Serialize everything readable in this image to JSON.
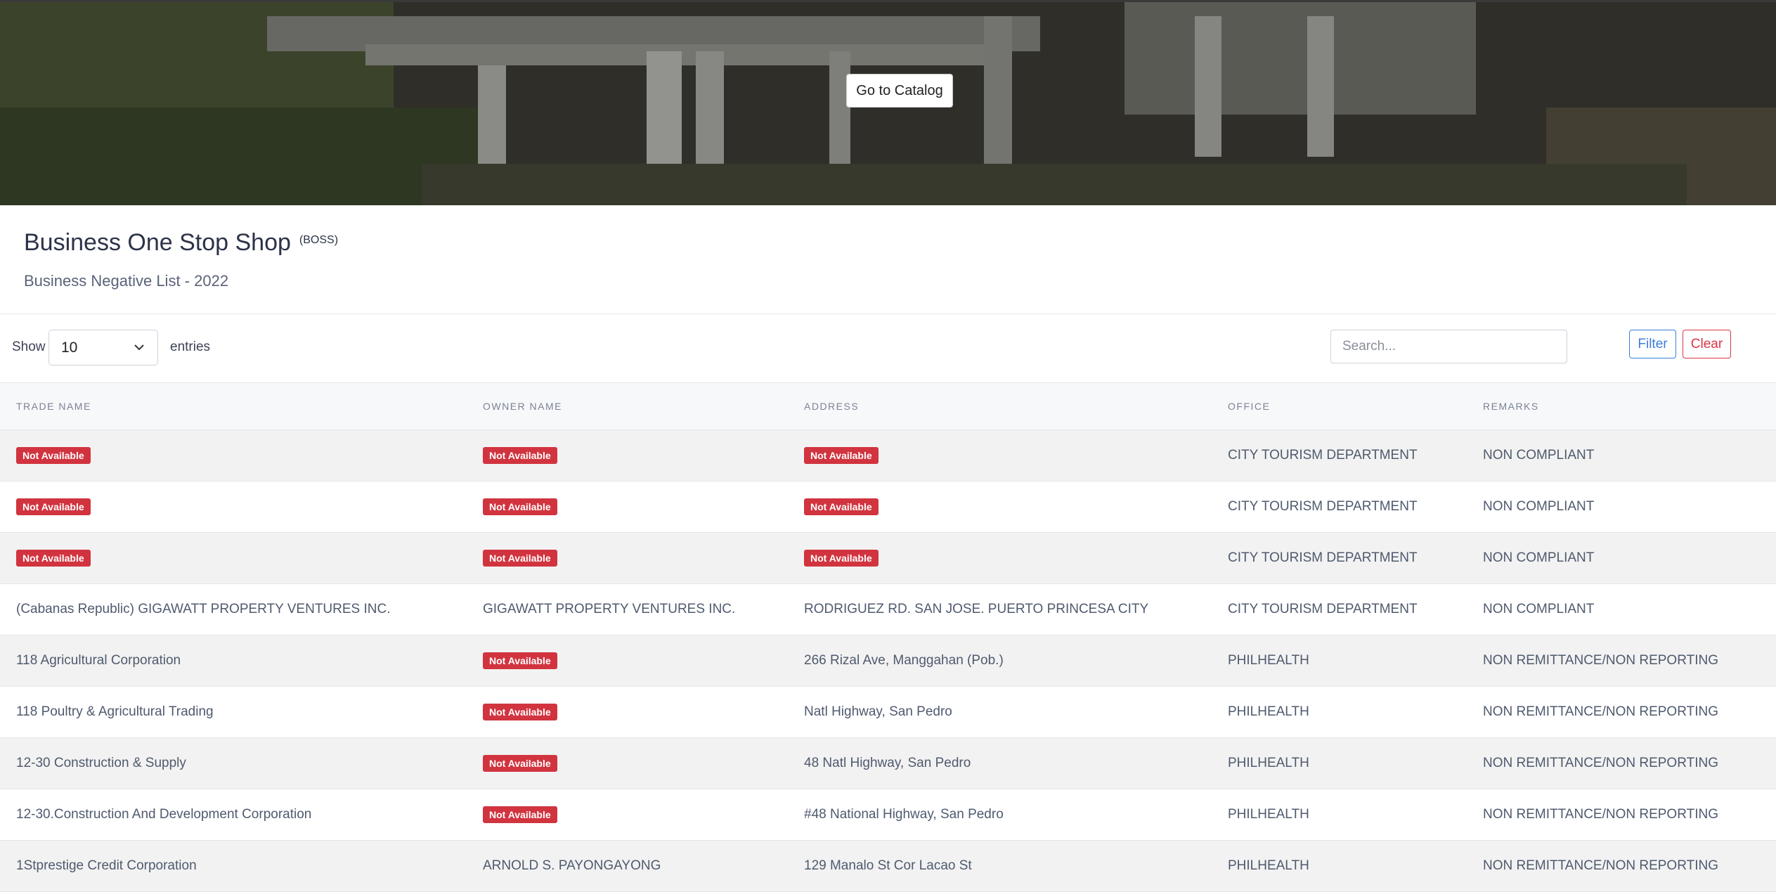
{
  "hero": {
    "catalog_button": "Go to Catalog"
  },
  "header": {
    "title": "Business One Stop Shop",
    "title_abbr": "(BOSS)",
    "subtitle": "Business Negative List - 2022"
  },
  "controls": {
    "show_label": "Show",
    "entries_value": "10",
    "entries_label": "entries",
    "search_placeholder": "Search...",
    "filter_label": "Filter",
    "clear_label": "Clear"
  },
  "table": {
    "columns": [
      "TRADE NAME",
      "OWNER NAME",
      "ADDRESS",
      "OFFICE",
      "REMARKS"
    ],
    "na_label": "Not Available",
    "rows": [
      {
        "trade": null,
        "owner": null,
        "address": null,
        "office": "CITY TOURISM DEPARTMENT",
        "remarks": "NON COMPLIANT"
      },
      {
        "trade": null,
        "owner": null,
        "address": null,
        "office": "CITY TOURISM DEPARTMENT",
        "remarks": "NON COMPLIANT"
      },
      {
        "trade": null,
        "owner": null,
        "address": null,
        "office": "CITY TOURISM DEPARTMENT",
        "remarks": "NON COMPLIANT"
      },
      {
        "trade": "(Cabanas Republic) GIGAWATT PROPERTY VENTURES INC.",
        "owner": "GIGAWATT PROPERTY VENTURES INC.",
        "address": "RODRIGUEZ RD. SAN JOSE. PUERTO PRINCESA CITY",
        "office": "CITY TOURISM DEPARTMENT",
        "remarks": "NON COMPLIANT"
      },
      {
        "trade": "118 Agricultural Corporation",
        "owner": null,
        "address": "266 Rizal Ave, Manggahan (Pob.)",
        "office": "PHILHEALTH",
        "remarks": "NON REMITTANCE/NON REPORTING"
      },
      {
        "trade": "118 Poultry & Agricultural Trading",
        "owner": null,
        "address": "Natl Highway, San Pedro",
        "office": "PHILHEALTH",
        "remarks": "NON REMITTANCE/NON REPORTING"
      },
      {
        "trade": "12-30 Construction & Supply",
        "owner": null,
        "address": "48 Natl Highway, San Pedro",
        "office": "PHILHEALTH",
        "remarks": "NON REMITTANCE/NON REPORTING"
      },
      {
        "trade": "12-30.Construction And Development Corporation",
        "owner": null,
        "address": "#48 National Highway, San Pedro",
        "office": "PHILHEALTH",
        "remarks": "NON REMITTANCE/NON REPORTING"
      },
      {
        "trade": "1Stprestige Credit Corporation",
        "owner": "ARNOLD S. PAYONGAYONG",
        "address": "129 Manalo St Cor Lacao St",
        "office": "PHILHEALTH",
        "remarks": "NON REMITTANCE/NON REPORTING"
      }
    ]
  },
  "colors": {
    "badge_red": "#d1343f",
    "filter_blue": "#3b7ddd",
    "clear_red": "#dc3545"
  }
}
